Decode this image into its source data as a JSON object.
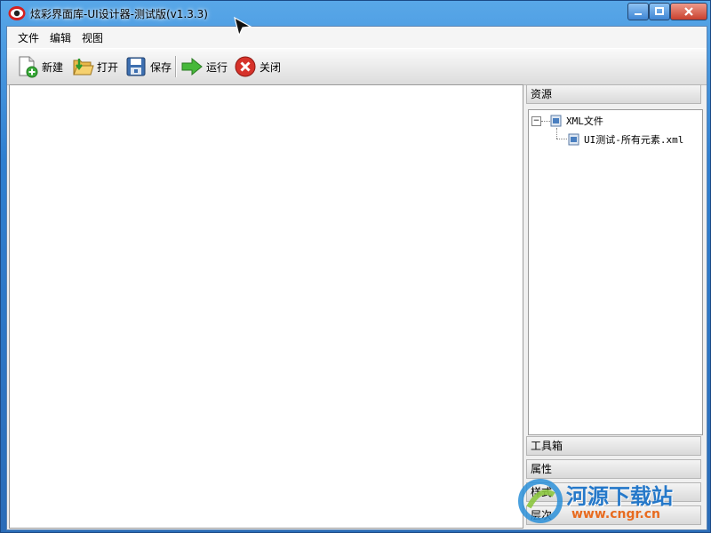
{
  "window": {
    "title": "炫彩界面库-UI设计器-测试版(v1.3.3)"
  },
  "menu": {
    "items": [
      "文件",
      "编辑",
      "视图"
    ]
  },
  "toolbar": {
    "new": "新建",
    "open": "打开",
    "save": "保存",
    "run": "运行",
    "close": "关闭"
  },
  "sidebar": {
    "resources_title": "资源",
    "tree": {
      "root": "XML文件",
      "child": "UI测试-所有元素.xml"
    },
    "toolbox_title": "工具箱",
    "properties_title": "属性",
    "panel4_title": "样式",
    "panel5_title": "层次"
  },
  "watermark": {
    "title": "河源下载站",
    "url": "www.cngr.cn"
  },
  "colors": {
    "accent": "#2f7fd0",
    "close": "#c9412e"
  }
}
